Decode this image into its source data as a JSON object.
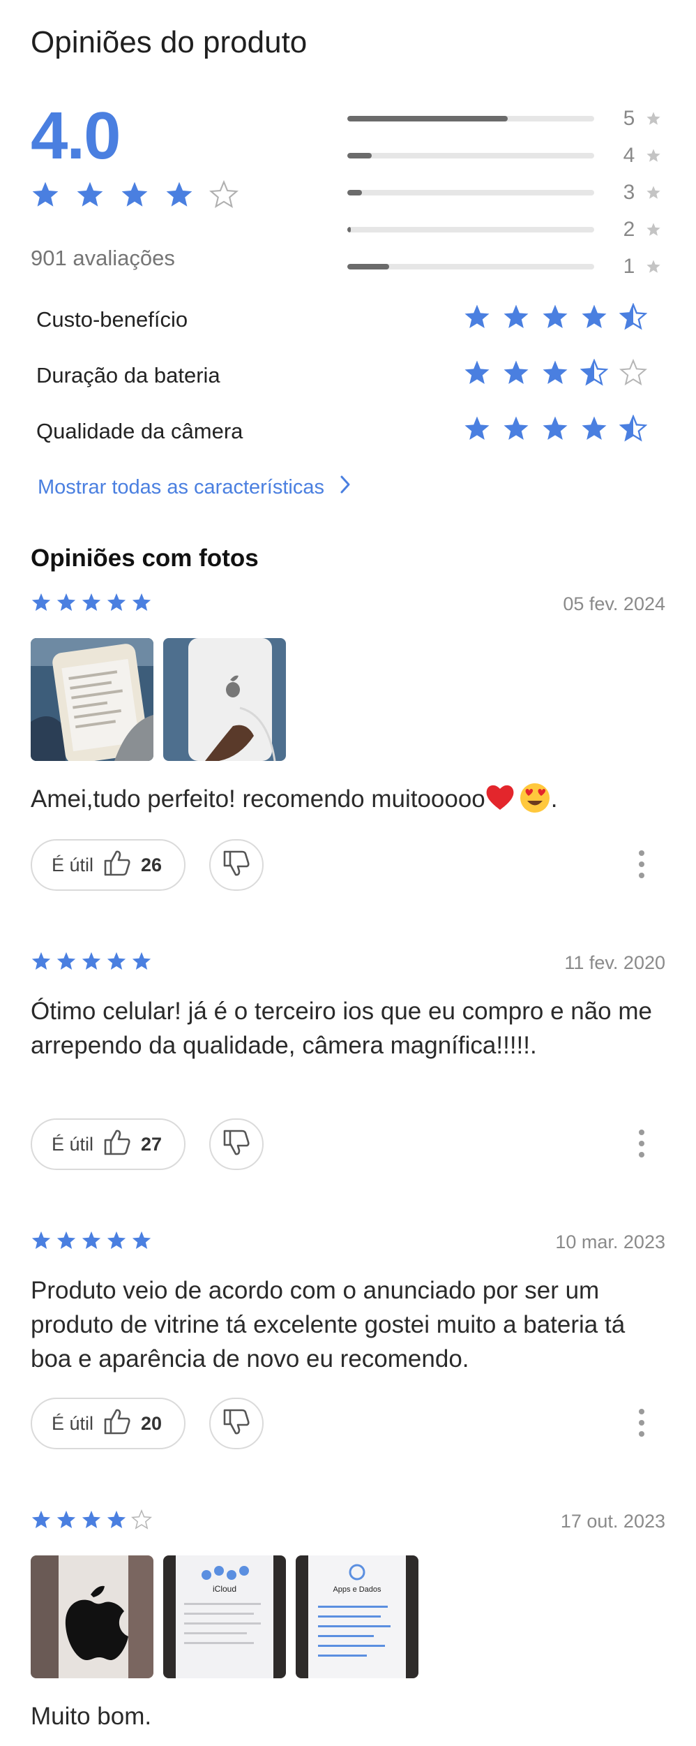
{
  "header": {
    "title": "Opiniões do produto"
  },
  "summary": {
    "score": "4.0",
    "stars_filled": 4,
    "stars_total": 5,
    "count_text": "901 avaliações",
    "accent_color": "#4a7fe0",
    "distribution": [
      {
        "label": "5",
        "fraction": 0.65
      },
      {
        "label": "4",
        "fraction": 0.1
      },
      {
        "label": "3",
        "fraction": 0.06
      },
      {
        "label": "2",
        "fraction": 0.015
      },
      {
        "label": "1",
        "fraction": 0.17
      }
    ]
  },
  "attributes": [
    {
      "label": "Custo-benefício",
      "rating": 4.5
    },
    {
      "label": "Duração da bateria",
      "rating": 3.5
    },
    {
      "label": "Qualidade da câmera",
      "rating": 4.5
    }
  ],
  "show_all": {
    "label": "Mostrar todas as características",
    "icon": "chevron-right-icon"
  },
  "photos_section": {
    "title": "Opiniões com fotos"
  },
  "reviews": [
    {
      "rating": 5,
      "date": "05 fev. 2024",
      "text": "Amei,tudo perfeito! recomendo muitooooo",
      "text_suffix": ".",
      "emojis": [
        "red-heart-emoji",
        "heart-eyes-emoji"
      ],
      "useful_label": "É útil",
      "useful_count": "26",
      "photos": [
        "phone-front-photo",
        "phone-back-photo"
      ]
    },
    {
      "rating": 5,
      "date": "11 fev. 2020",
      "text": "Ótimo celular! já é o terceiro ios que eu compro e não me arrependo da qualidade, câmera magnífica!!!!!.",
      "useful_label": "É útil",
      "useful_count": "27",
      "photos": []
    },
    {
      "rating": 5,
      "date": "10 mar. 2023",
      "text": "Produto veio de acordo com o anunciado por ser um produto de vitrine tá excelente gostei muito a bateria tá boa e aparência de novo eu recomendo.",
      "useful_label": "É útil",
      "useful_count": "20",
      "photos": []
    },
    {
      "rating": 4,
      "date": "17 out. 2023",
      "text": "Muito bom.",
      "photos": [
        "apple-logo-photo",
        "icloud-screen-photo",
        "apps-data-screen-photo"
      ],
      "photo_texts": {
        "icloud": "iCloud",
        "apps": "Apps e Dados"
      }
    }
  ]
}
